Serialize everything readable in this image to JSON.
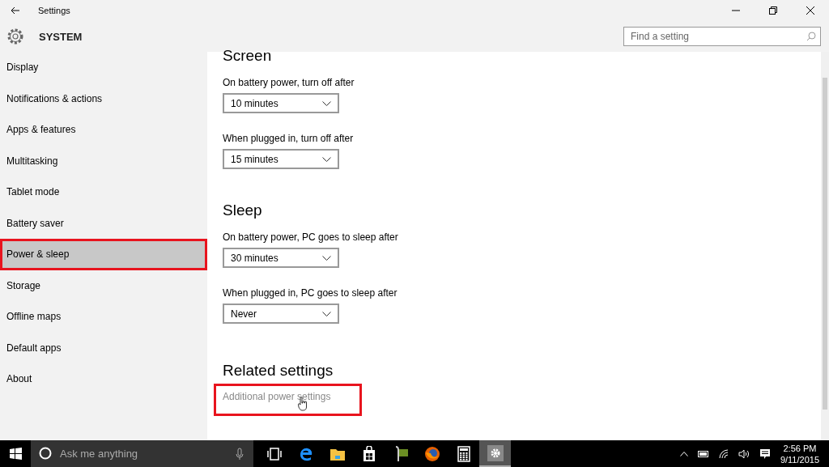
{
  "window": {
    "title": "Settings"
  },
  "header": {
    "title": "SYSTEM",
    "search": {
      "placeholder": "Find a setting"
    }
  },
  "sidebar": {
    "items": [
      {
        "label": "Display",
        "selected": false,
        "highlighted": false
      },
      {
        "label": "Notifications & actions",
        "selected": false,
        "highlighted": false
      },
      {
        "label": "Apps & features",
        "selected": false,
        "highlighted": false
      },
      {
        "label": "Multitasking",
        "selected": false,
        "highlighted": false
      },
      {
        "label": "Tablet mode",
        "selected": false,
        "highlighted": false
      },
      {
        "label": "Battery saver",
        "selected": false,
        "highlighted": false
      },
      {
        "label": "Power & sleep",
        "selected": true,
        "highlighted": true
      },
      {
        "label": "Storage",
        "selected": false,
        "highlighted": false
      },
      {
        "label": "Offline maps",
        "selected": false,
        "highlighted": false
      },
      {
        "label": "Default apps",
        "selected": false,
        "highlighted": false
      },
      {
        "label": "About",
        "selected": false,
        "highlighted": false
      }
    ]
  },
  "content": {
    "sections": [
      {
        "heading": "Screen",
        "settings": [
          {
            "label": "On battery power, turn off after",
            "value": "10 minutes"
          },
          {
            "label": "When plugged in, turn off after",
            "value": "15 minutes"
          }
        ]
      },
      {
        "heading": "Sleep",
        "settings": [
          {
            "label": "On battery power, PC goes to sleep after",
            "value": "30 minutes"
          },
          {
            "label": "When plugged in, PC goes to sleep after",
            "value": "Never"
          }
        ]
      }
    ],
    "related": {
      "heading": "Related settings",
      "link": {
        "label": "Additional power settings",
        "highlighted": true
      }
    }
  },
  "taskbar": {
    "search": {
      "placeholder": "Ask me anything"
    },
    "apps": [
      {
        "kind": "taskview",
        "active": false
      },
      {
        "kind": "edge",
        "active": false
      },
      {
        "kind": "explorer",
        "active": false
      },
      {
        "kind": "store",
        "active": false
      },
      {
        "kind": "media",
        "active": false
      },
      {
        "kind": "firefox",
        "active": false
      },
      {
        "kind": "calculator",
        "active": false
      },
      {
        "kind": "settings",
        "active": true
      }
    ],
    "clock": {
      "time": "2:56 PM",
      "date": "9/11/2015"
    }
  }
}
